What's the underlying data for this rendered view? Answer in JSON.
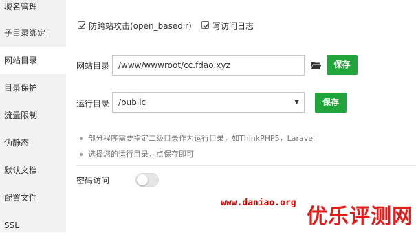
{
  "sidebar": {
    "items": [
      {
        "label": "域名管理"
      },
      {
        "label": "子目录绑定"
      },
      {
        "label": "网站目录",
        "active": true
      },
      {
        "label": "目录保护"
      },
      {
        "label": "流量限制"
      },
      {
        "label": "伪静态"
      },
      {
        "label": "默认文档"
      },
      {
        "label": "配置文件"
      },
      {
        "label": "SSL"
      }
    ]
  },
  "options": {
    "anti_xss_label": "防跨站攻击(open_basedir)",
    "anti_xss_checked": true,
    "access_log_label": "写访问日志",
    "access_log_checked": true
  },
  "site_dir": {
    "label": "网站目录",
    "value": "/www/wwwroot/cc.fdao.xyz",
    "save_label": "保存",
    "folder_icon": "folder-open-icon"
  },
  "run_dir": {
    "label": "运行目录",
    "value": "/public",
    "save_label": "保存"
  },
  "hints": [
    "部分程序需要指定二级目录作为运行目录，如ThinkPHP5，Laravel",
    "选择您的运行目录，点保存即可"
  ],
  "password_access": {
    "label": "密码访问",
    "enabled": false
  },
  "watermark": {
    "url": "www.daniao.org",
    "title": "优乐评测网"
  },
  "colors": {
    "accent_green": "#20a53a",
    "watermark_red": "#e21b1b"
  }
}
